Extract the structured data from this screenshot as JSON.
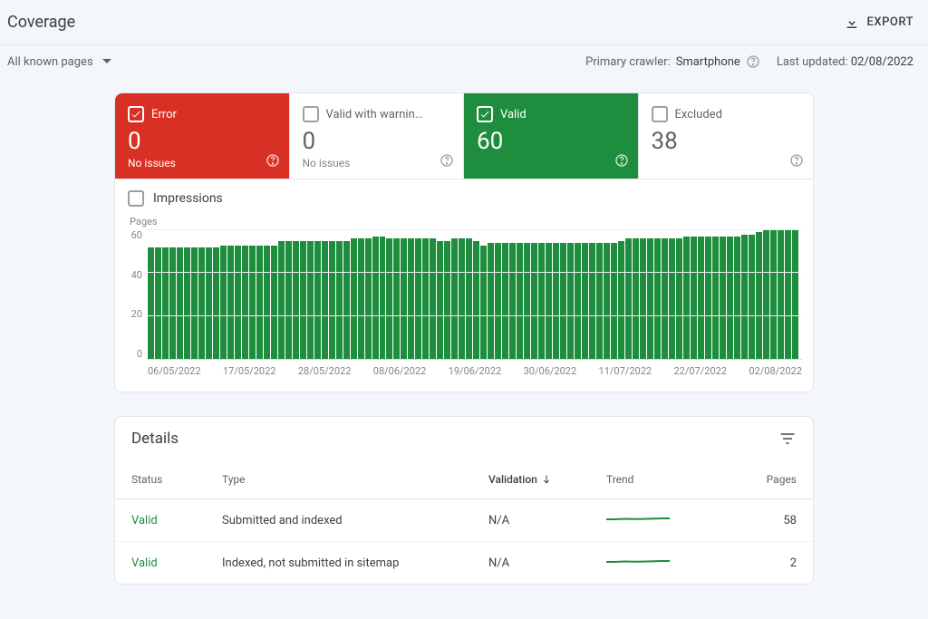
{
  "header": {
    "title": "Coverage",
    "export_label": "EXPORT"
  },
  "filters": {
    "pages_selector": "All known pages",
    "primary_crawler_label": "Primary crawler:",
    "primary_crawler_value": "Smartphone",
    "last_updated_label": "Last updated:",
    "last_updated_value": "02/08/2022"
  },
  "tiles": {
    "error": {
      "label": "Error",
      "count": "0",
      "sub": "No issues"
    },
    "warning": {
      "label": "Valid with warnin…",
      "count": "0",
      "sub": "No issues"
    },
    "valid": {
      "label": "Valid",
      "count": "60"
    },
    "excluded": {
      "label": "Excluded",
      "count": "38"
    }
  },
  "impressions_label": "Impressions",
  "chart_data": {
    "type": "bar",
    "ylabel": "Pages",
    "ylim": [
      0,
      60
    ],
    "yticks": [
      0,
      20,
      40,
      60
    ],
    "categories": [
      "06/05/2022",
      "17/05/2022",
      "28/05/2022",
      "08/06/2022",
      "19/06/2022",
      "30/06/2022",
      "11/07/2022",
      "22/07/2022",
      "02/08/2022"
    ],
    "values": [
      52,
      52,
      52,
      52,
      52,
      52,
      52,
      52,
      52,
      52,
      53,
      53,
      53,
      53,
      53,
      53,
      53,
      53,
      55,
      55,
      55,
      55,
      55,
      55,
      55,
      55,
      55,
      55,
      56,
      56,
      56,
      57,
      57,
      56,
      56,
      56,
      56,
      56,
      56,
      56,
      55,
      55,
      56,
      56,
      56,
      55,
      53,
      54,
      54,
      54,
      54,
      54,
      54,
      54,
      54,
      54,
      54,
      54,
      54,
      54,
      54,
      54,
      54,
      54,
      54,
      55,
      56,
      56,
      56,
      56,
      56,
      56,
      56,
      56,
      57,
      57,
      57,
      57,
      57,
      57,
      57,
      57,
      58,
      58,
      59,
      60,
      60,
      60,
      60,
      60
    ]
  },
  "details": {
    "title": "Details",
    "columns": {
      "status": "Status",
      "type": "Type",
      "validation": "Validation",
      "trend": "Trend",
      "pages": "Pages"
    },
    "rows": [
      {
        "status": "Valid",
        "type": "Submitted and indexed",
        "validation": "N/A",
        "pages": "58"
      },
      {
        "status": "Valid",
        "type": "Indexed, not submitted in sitemap",
        "validation": "N/A",
        "pages": "2"
      }
    ]
  }
}
